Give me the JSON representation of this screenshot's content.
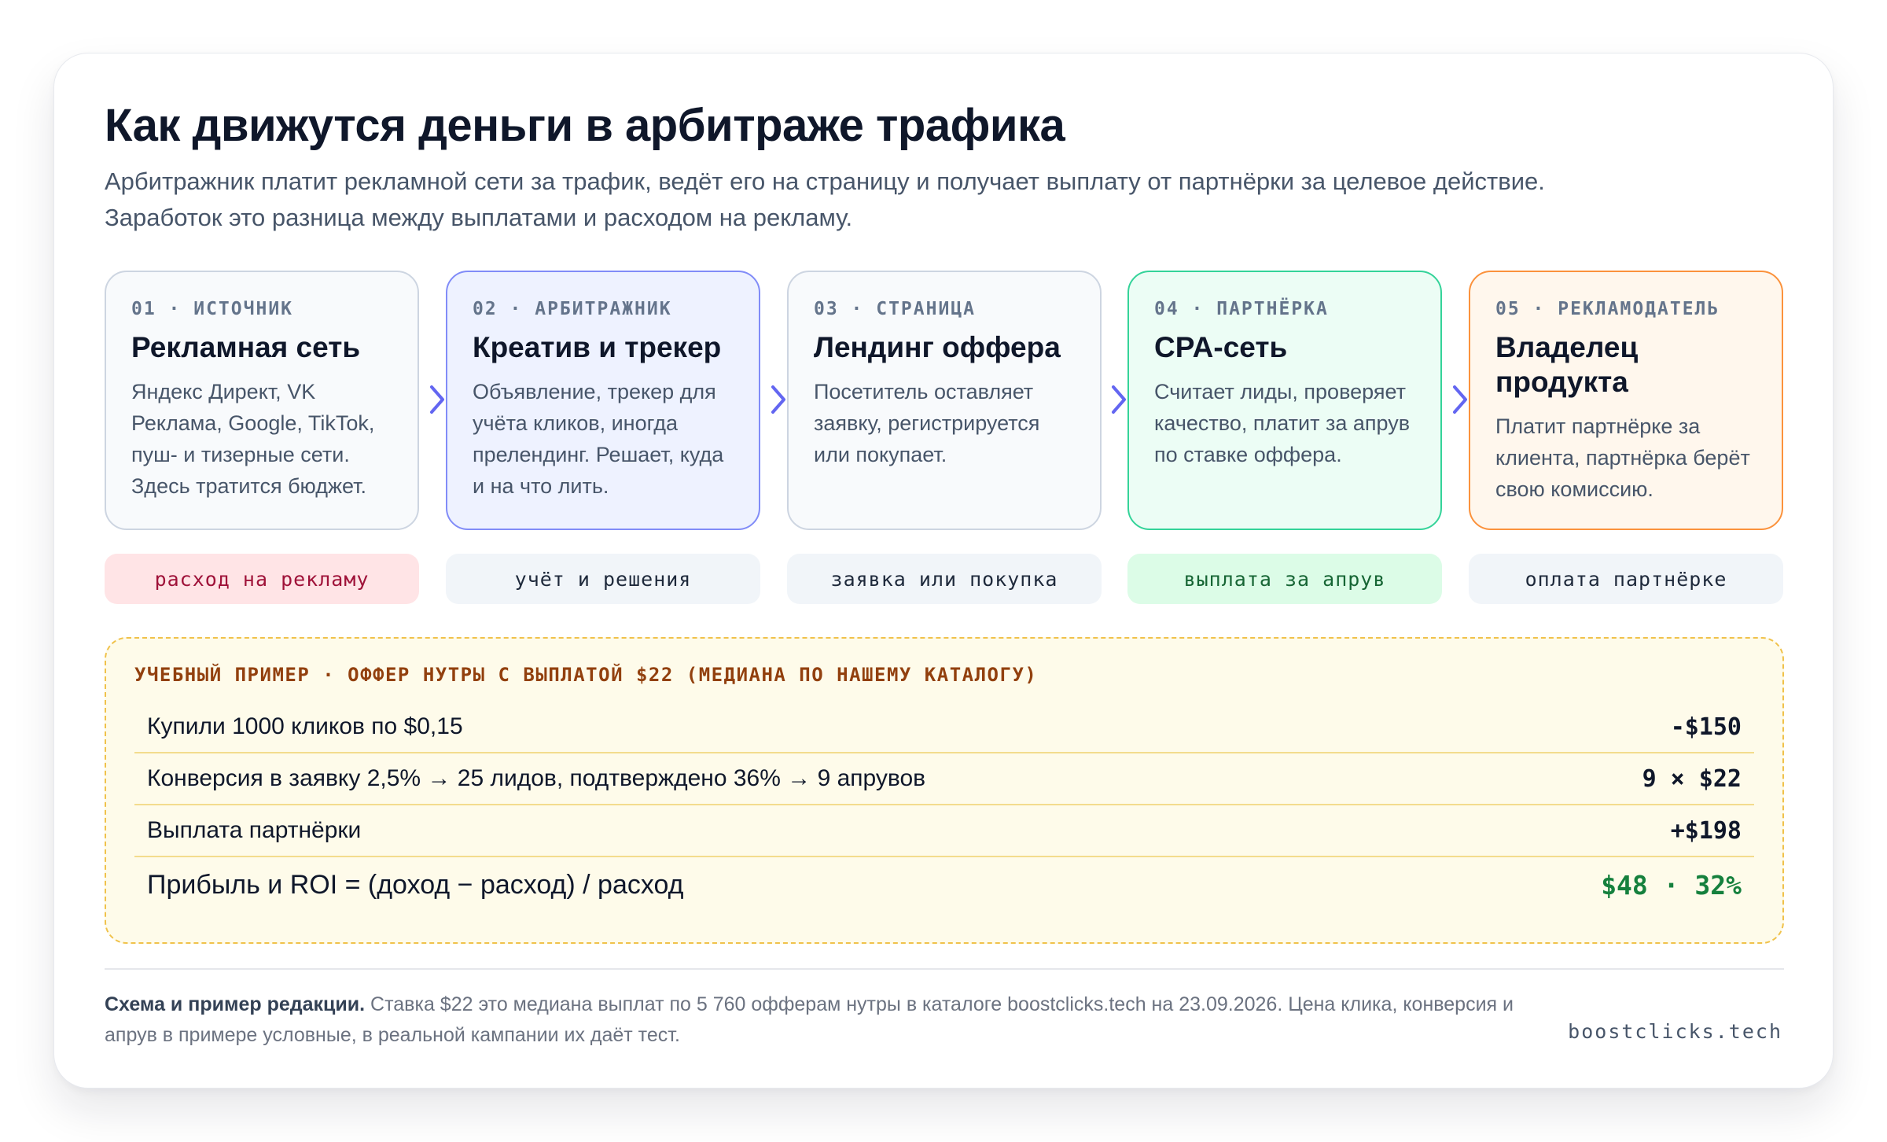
{
  "header": {
    "title": "Как движутся деньги в арбитраже трафика",
    "subtitle_line1": "Арбитражник платит рекламной сети за трафик, ведёт его на страницу и получает выплату от партнёрки за целевое действие.",
    "subtitle_line2": "Заработок это разница между выплатами и расходом на рекламу."
  },
  "steps": [
    {
      "kicker": "01 · ИСТОЧНИК",
      "name": "Рекламная сеть",
      "description": "Яндекс Директ, VK Реклама, Google, TikTok, пуш- и тизерные сети. Здесь тратится бюджет."
    },
    {
      "kicker": "02 · АРБИТРАЖНИК",
      "name": "Креатив и трекер",
      "description": "Объявление, трекер для учёта кликов, иногда прелендинг. Решает, куда и на что лить."
    },
    {
      "kicker": "03 · СТРАНИЦА",
      "name": "Лендинг оффера",
      "description": "Посетитель оставляет заявку, регистрируется или покупает."
    },
    {
      "kicker": "04 · ПАРТНЁРКА",
      "name": "CPA-сеть",
      "description": "Считает лиды, проверяет качество, платит за апрув по ставке оффера."
    },
    {
      "kicker": "05 · РЕКЛАМОДАТЕЛЬ",
      "name": "Владелец продукта",
      "description": "Платит партнёрке за клиента, партнёрка берёт свою комиссию."
    }
  ],
  "flows": [
    {
      "label": "расход на рекламу"
    },
    {
      "label": "учёт и решения"
    },
    {
      "label": "заявка или покупка"
    },
    {
      "label": "выплата за апрув"
    },
    {
      "label": "оплата партнёрке"
    }
  ],
  "example": {
    "title": "УЧЕБНЫЙ ПРИМЕР · ОФФЕР НУТРЫ С ВЫПЛАТОЙ $22 (МЕДИАНА ПО НАШЕМУ КАТАЛОГУ)",
    "rows": [
      {
        "label": "Купили 1000 кликов по $0,15",
        "value": "-$150"
      },
      {
        "label": "Конверсия в заявку 2,5% → 25 лидов, подтверждено 36% → 9 апрувов",
        "value": "9 × $22"
      },
      {
        "label": "Выплата партнёрки",
        "value": "+$198"
      },
      {
        "label": "Прибыль и ROI = (доход − расход) / расход",
        "value": "$48 · 32%"
      }
    ]
  },
  "footer": {
    "note_bold": "Схема и пример редакции.",
    "note_text": " Ставка $22 это медиана выплат по 5 760 офферам нутры в каталоге boostclicks.tech на 23.09.2026. Цена клика, конверсия и апрув в примере условные, в реальной кампании их даёт тест.",
    "brand": "boostclicks.tech"
  },
  "colors": {
    "arrow": "#6366f1",
    "accent_blue": "#818cf8",
    "accent_green": "#34d399",
    "accent_orange": "#fb923c",
    "profit_green": "#15803d"
  },
  "icons": [
    "chevron-right-icon"
  ]
}
